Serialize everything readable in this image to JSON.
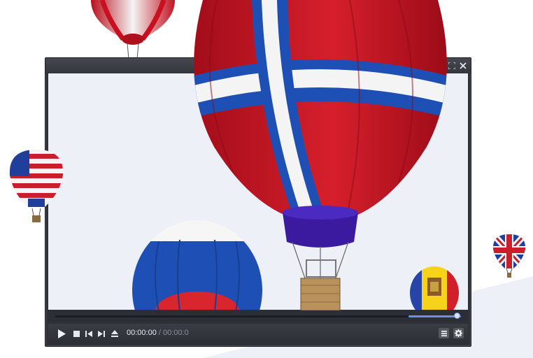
{
  "player": {
    "time": {
      "current": "00:00:00",
      "separator": " / ",
      "total": "00:00:0"
    },
    "progress_fraction": 0.0,
    "volume_fraction": 0.9,
    "icons": {
      "fullscreen": "fullscreen-icon",
      "close": "close-icon",
      "play": "play-icon",
      "stop": "stop-icon",
      "previous": "skip-back-icon",
      "next": "skip-forward-icon",
      "eject": "eject-icon",
      "playlist": "playlist-icon",
      "settings": "gear-icon"
    }
  },
  "colors": {
    "frame": "#2e3138",
    "video_bg": "#eef0f7",
    "accent": "#6f8fe0"
  }
}
